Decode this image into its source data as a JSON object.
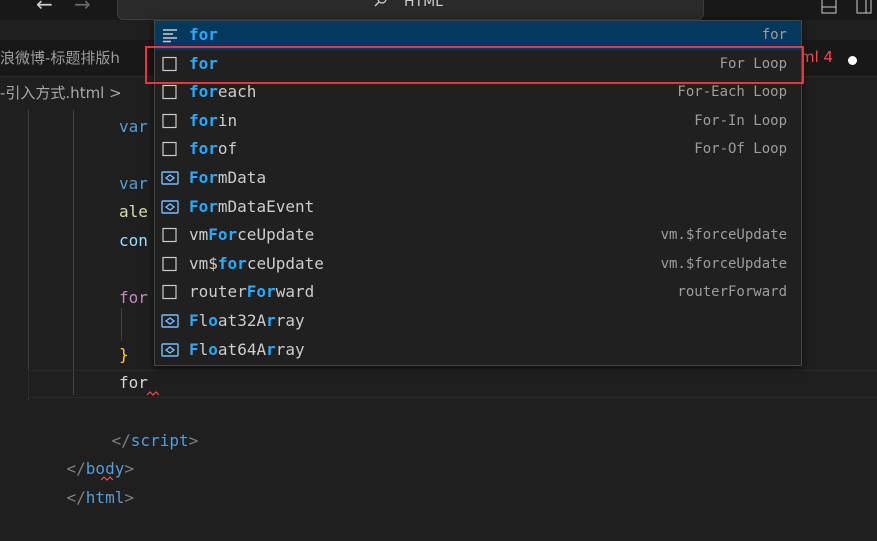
{
  "titlebar": {
    "search_text": "HTML"
  },
  "tab": {
    "label": "浪微博-标题排版h",
    "status": "ml 4"
  },
  "breadcrumb": {
    "text": "-引入方式.html >"
  },
  "code": {
    "line_var1": "var",
    "line_var2": "var",
    "line_ale": "ale",
    "line_con": "con",
    "line_for1": "for",
    "line_brace": "}",
    "line_for2": "for",
    "line_script_open": "</",
    "line_script_name": "script",
    "line_script_close": ">",
    "line_body_open": "</",
    "line_body_name": "body",
    "line_body_close": ">",
    "line_html_open": "</",
    "line_html_name": "html",
    "line_html_close": ">"
  },
  "suggest": {
    "items": [
      {
        "pre": "",
        "hl": "for",
        "post": "",
        "detail": "for",
        "icon": "snippet-icon"
      },
      {
        "pre": "",
        "hl": "for",
        "post": "",
        "detail": "For Loop",
        "icon": "square-snippet-icon"
      },
      {
        "pre": "",
        "hl": "for",
        "post": "each",
        "detail": "For-Each Loop",
        "icon": "square-snippet-icon"
      },
      {
        "pre": "",
        "hl": "for",
        "post": "in",
        "detail": "For-In Loop",
        "icon": "square-snippet-icon"
      },
      {
        "pre": "",
        "hl": "for",
        "post": "of",
        "detail": "For-Of Loop",
        "icon": "square-snippet-icon"
      },
      {
        "pre": "",
        "hl": "For",
        "post": "mData",
        "detail": "",
        "icon": "variable-icon"
      },
      {
        "pre": "",
        "hl": "For",
        "post": "mDataEvent",
        "detail": "",
        "icon": "variable-icon"
      },
      {
        "pre": "vm",
        "hl": "For",
        "post": "ceUpdate",
        "detail": "vm.$forceUpdate",
        "icon": "square-snippet-icon"
      },
      {
        "pre": "vm$",
        "hl": "for",
        "post": "ceUpdate",
        "detail": "vm.$forceUpdate",
        "icon": "square-snippet-icon"
      },
      {
        "pre": "router",
        "hl": "For",
        "post": "ward",
        "detail": "routerForward",
        "icon": "square-snippet-icon"
      },
      {
        "pre": "",
        "hl": "F",
        "post": "l",
        "hl2": "o",
        "post2": "at32A",
        "hl3": "r",
        "post3": "ray",
        "detail": "",
        "icon": "variable-icon"
      },
      {
        "pre": "",
        "hl": "F",
        "post": "l",
        "hl2": "o",
        "post2": "at64A",
        "hl3": "r",
        "post3": "ray",
        "detail": "",
        "icon": "variable-icon"
      }
    ]
  },
  "colors": {
    "selection": "#04395e",
    "highlight": "#2aaaff",
    "annotation_box": "#e0393e"
  }
}
